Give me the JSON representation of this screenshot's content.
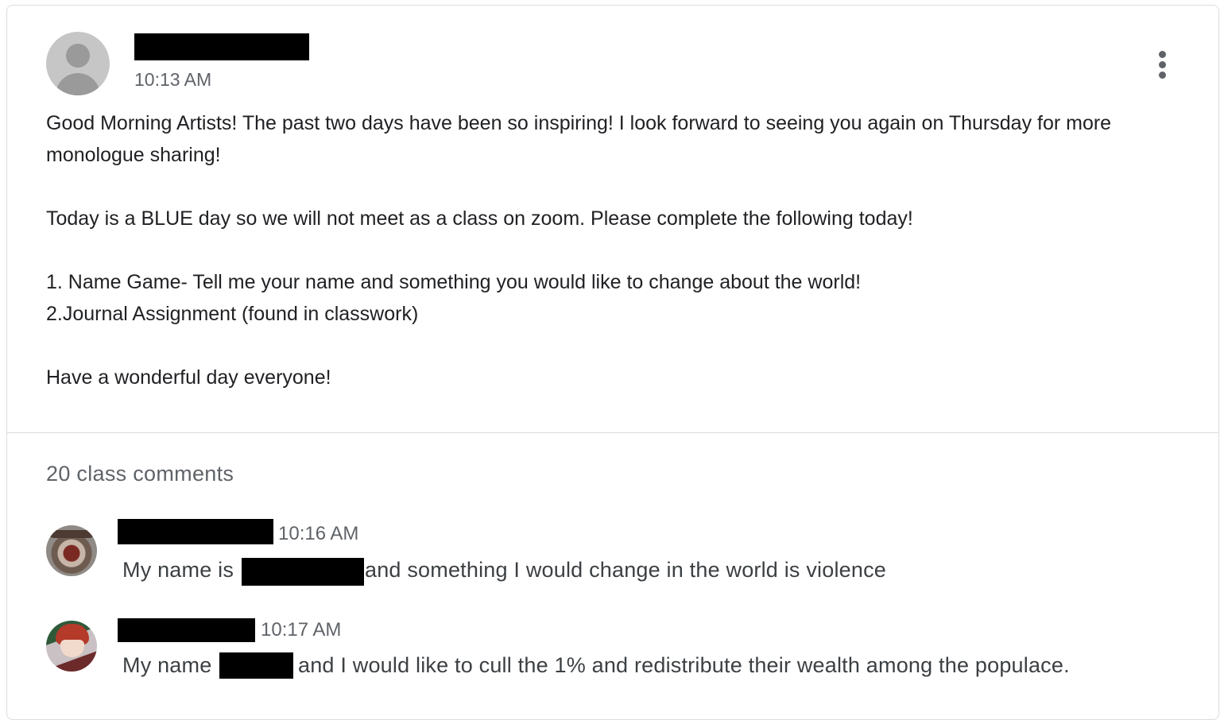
{
  "post": {
    "author_name": "",
    "time": "10:13 AM",
    "paragraphs": [
      "Good Morning Artists!  The past two days have been so inspiring! I look forward to seeing you again on Thursday for more monologue sharing!",
      "",
      "Today is a BLUE day so we will not meet as a class on zoom.  Please complete the following today!",
      "",
      "1. Name Game- Tell me your name and something you would like to change about the world!",
      "2.Journal Assignment (found in classwork)",
      "",
      "Have a wonderful day everyone!"
    ],
    "more_icon": "more-vert-icon"
  },
  "comments_section": {
    "count_label": "20 class comments",
    "comments": [
      {
        "time": "10:16 AM",
        "text_before": "My name is",
        "text_after": "and something I would change in the world is violence"
      },
      {
        "time": "10:17 AM",
        "text_before": "My name",
        "text_after": "and I would like to cull the 1% and redistribute their wealth among the populace."
      }
    ]
  },
  "colors": {
    "text_primary": "#202124",
    "text_secondary": "#5f6368",
    "divider": "#dadce0",
    "redaction": "#000000"
  }
}
